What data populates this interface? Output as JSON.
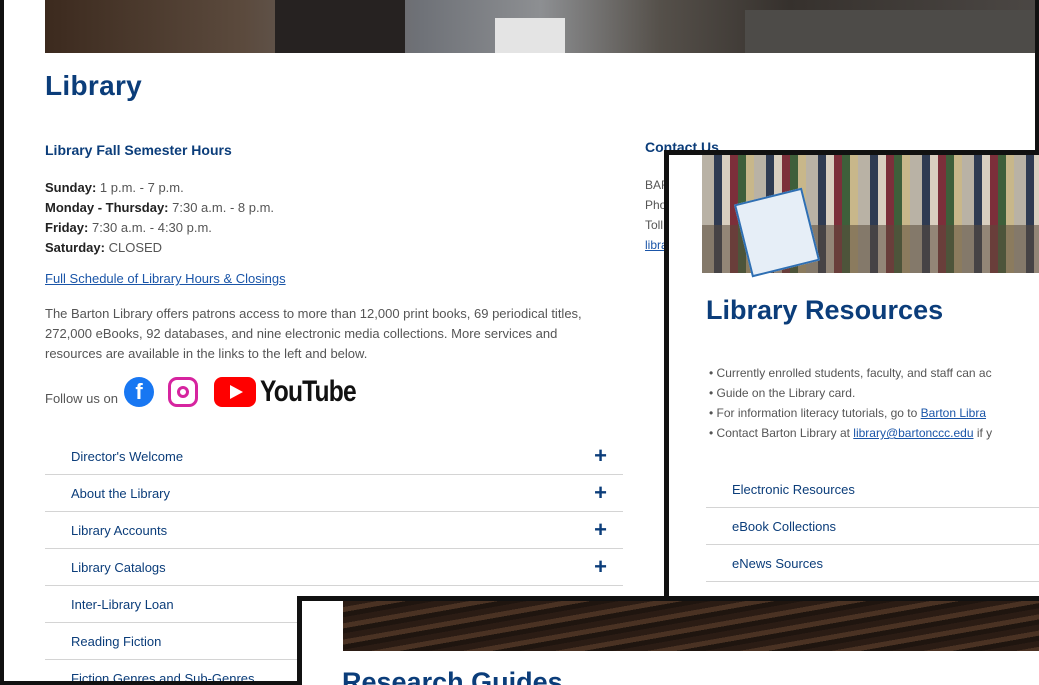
{
  "library_page": {
    "title": "Library",
    "hours_heading": "Library Fall Semester Hours",
    "hours": [
      {
        "day": "Sunday:",
        "time": "1 p.m. - 7 p.m."
      },
      {
        "day": "Monday - Thursday:",
        "time": "7:30 a.m. - 8 p.m."
      },
      {
        "day": "Friday:",
        "time": "7:30 a.m. - 4:30 p.m."
      },
      {
        "day": "Saturday:",
        "time": "CLOSED"
      }
    ],
    "full_schedule_link": "Full Schedule of Library Hours & Closings",
    "intro": "The Barton Library offers patrons access to more than 12,000 print books, 69 periodical titles, 272,000 eBooks, 92 databases, and nine electronic media collections. More services and resources are available in the links to the left and below.",
    "follow_label": "Follow us on",
    "social": {
      "facebook": "f",
      "youtube_text": "YouTube"
    },
    "accordion": [
      {
        "label": "Director's Welcome",
        "icon": "+"
      },
      {
        "label": "About the Library",
        "icon": "+"
      },
      {
        "label": "Library Accounts",
        "icon": "+"
      },
      {
        "label": "Library Catalogs",
        "icon": "+"
      },
      {
        "label": "Inter-Library Loan",
        "icon": ""
      },
      {
        "label": "Reading Fiction",
        "icon": ""
      },
      {
        "label": "Fiction Genres and Sub-Genres",
        "icon": ""
      }
    ],
    "contact": {
      "heading": "Contact Us",
      "lines": [
        "BAR",
        "Pho",
        "Toll"
      ],
      "link": "libra"
    }
  },
  "resources_page": {
    "title": "Library Resources",
    "bullets": [
      {
        "text": "Currently enrolled students, faculty, and staff can ac",
        "link": ""
      },
      {
        "text": "Guide on the Library card.",
        "link": ""
      },
      {
        "text": "For information literacy tutorials, go to ",
        "link": "Barton Libra"
      },
      {
        "text": "Contact Barton Library at ",
        "link": "library@bartonccc.edu",
        "after": " if y"
      }
    ],
    "accordion": [
      "Electronic Resources",
      "eBook Collections",
      "eNews Sources"
    ]
  },
  "guides_page": {
    "title": "Research Guides"
  },
  "colors": {
    "heading_blue": "#0b3d7a",
    "link_blue": "#1a55a8",
    "facebook": "#1877f2",
    "youtube_red": "#ff0000",
    "instagram": "#d6249f"
  }
}
